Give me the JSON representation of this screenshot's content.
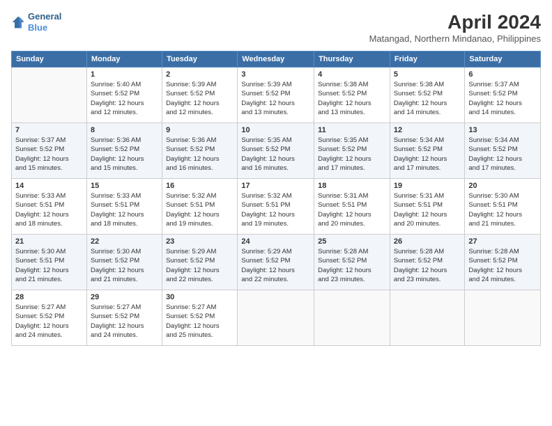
{
  "header": {
    "logo": {
      "general": "General",
      "blue": "Blue"
    },
    "title": "April 2024",
    "location": "Matangad, Northern Mindanao, Philippines"
  },
  "columns": [
    "Sunday",
    "Monday",
    "Tuesday",
    "Wednesday",
    "Thursday",
    "Friday",
    "Saturday"
  ],
  "weeks": [
    [
      {
        "day": "",
        "sunrise": "",
        "sunset": "",
        "daylight": ""
      },
      {
        "day": "1",
        "sunrise": "Sunrise: 5:40 AM",
        "sunset": "Sunset: 5:52 PM",
        "daylight": "Daylight: 12 hours and 12 minutes."
      },
      {
        "day": "2",
        "sunrise": "Sunrise: 5:39 AM",
        "sunset": "Sunset: 5:52 PM",
        "daylight": "Daylight: 12 hours and 12 minutes."
      },
      {
        "day": "3",
        "sunrise": "Sunrise: 5:39 AM",
        "sunset": "Sunset: 5:52 PM",
        "daylight": "Daylight: 12 hours and 13 minutes."
      },
      {
        "day": "4",
        "sunrise": "Sunrise: 5:38 AM",
        "sunset": "Sunset: 5:52 PM",
        "daylight": "Daylight: 12 hours and 13 minutes."
      },
      {
        "day": "5",
        "sunrise": "Sunrise: 5:38 AM",
        "sunset": "Sunset: 5:52 PM",
        "daylight": "Daylight: 12 hours and 14 minutes."
      },
      {
        "day": "6",
        "sunrise": "Sunrise: 5:37 AM",
        "sunset": "Sunset: 5:52 PM",
        "daylight": "Daylight: 12 hours and 14 minutes."
      }
    ],
    [
      {
        "day": "7",
        "sunrise": "Sunrise: 5:37 AM",
        "sunset": "Sunset: 5:52 PM",
        "daylight": "Daylight: 12 hours and 15 minutes."
      },
      {
        "day": "8",
        "sunrise": "Sunrise: 5:36 AM",
        "sunset": "Sunset: 5:52 PM",
        "daylight": "Daylight: 12 hours and 15 minutes."
      },
      {
        "day": "9",
        "sunrise": "Sunrise: 5:36 AM",
        "sunset": "Sunset: 5:52 PM",
        "daylight": "Daylight: 12 hours and 16 minutes."
      },
      {
        "day": "10",
        "sunrise": "Sunrise: 5:35 AM",
        "sunset": "Sunset: 5:52 PM",
        "daylight": "Daylight: 12 hours and 16 minutes."
      },
      {
        "day": "11",
        "sunrise": "Sunrise: 5:35 AM",
        "sunset": "Sunset: 5:52 PM",
        "daylight": "Daylight: 12 hours and 17 minutes."
      },
      {
        "day": "12",
        "sunrise": "Sunrise: 5:34 AM",
        "sunset": "Sunset: 5:52 PM",
        "daylight": "Daylight: 12 hours and 17 minutes."
      },
      {
        "day": "13",
        "sunrise": "Sunrise: 5:34 AM",
        "sunset": "Sunset: 5:52 PM",
        "daylight": "Daylight: 12 hours and 17 minutes."
      }
    ],
    [
      {
        "day": "14",
        "sunrise": "Sunrise: 5:33 AM",
        "sunset": "Sunset: 5:51 PM",
        "daylight": "Daylight: 12 hours and 18 minutes."
      },
      {
        "day": "15",
        "sunrise": "Sunrise: 5:33 AM",
        "sunset": "Sunset: 5:51 PM",
        "daylight": "Daylight: 12 hours and 18 minutes."
      },
      {
        "day": "16",
        "sunrise": "Sunrise: 5:32 AM",
        "sunset": "Sunset: 5:51 PM",
        "daylight": "Daylight: 12 hours and 19 minutes."
      },
      {
        "day": "17",
        "sunrise": "Sunrise: 5:32 AM",
        "sunset": "Sunset: 5:51 PM",
        "daylight": "Daylight: 12 hours and 19 minutes."
      },
      {
        "day": "18",
        "sunrise": "Sunrise: 5:31 AM",
        "sunset": "Sunset: 5:51 PM",
        "daylight": "Daylight: 12 hours and 20 minutes."
      },
      {
        "day": "19",
        "sunrise": "Sunrise: 5:31 AM",
        "sunset": "Sunset: 5:51 PM",
        "daylight": "Daylight: 12 hours and 20 minutes."
      },
      {
        "day": "20",
        "sunrise": "Sunrise: 5:30 AM",
        "sunset": "Sunset: 5:51 PM",
        "daylight": "Daylight: 12 hours and 21 minutes."
      }
    ],
    [
      {
        "day": "21",
        "sunrise": "Sunrise: 5:30 AM",
        "sunset": "Sunset: 5:51 PM",
        "daylight": "Daylight: 12 hours and 21 minutes."
      },
      {
        "day": "22",
        "sunrise": "Sunrise: 5:30 AM",
        "sunset": "Sunset: 5:52 PM",
        "daylight": "Daylight: 12 hours and 21 minutes."
      },
      {
        "day": "23",
        "sunrise": "Sunrise: 5:29 AM",
        "sunset": "Sunset: 5:52 PM",
        "daylight": "Daylight: 12 hours and 22 minutes."
      },
      {
        "day": "24",
        "sunrise": "Sunrise: 5:29 AM",
        "sunset": "Sunset: 5:52 PM",
        "daylight": "Daylight: 12 hours and 22 minutes."
      },
      {
        "day": "25",
        "sunrise": "Sunrise: 5:28 AM",
        "sunset": "Sunset: 5:52 PM",
        "daylight": "Daylight: 12 hours and 23 minutes."
      },
      {
        "day": "26",
        "sunrise": "Sunrise: 5:28 AM",
        "sunset": "Sunset: 5:52 PM",
        "daylight": "Daylight: 12 hours and 23 minutes."
      },
      {
        "day": "27",
        "sunrise": "Sunrise: 5:28 AM",
        "sunset": "Sunset: 5:52 PM",
        "daylight": "Daylight: 12 hours and 24 minutes."
      }
    ],
    [
      {
        "day": "28",
        "sunrise": "Sunrise: 5:27 AM",
        "sunset": "Sunset: 5:52 PM",
        "daylight": "Daylight: 12 hours and 24 minutes."
      },
      {
        "day": "29",
        "sunrise": "Sunrise: 5:27 AM",
        "sunset": "Sunset: 5:52 PM",
        "daylight": "Daylight: 12 hours and 24 minutes."
      },
      {
        "day": "30",
        "sunrise": "Sunrise: 5:27 AM",
        "sunset": "Sunset: 5:52 PM",
        "daylight": "Daylight: 12 hours and 25 minutes."
      },
      {
        "day": "",
        "sunrise": "",
        "sunset": "",
        "daylight": ""
      },
      {
        "day": "",
        "sunrise": "",
        "sunset": "",
        "daylight": ""
      },
      {
        "day": "",
        "sunrise": "",
        "sunset": "",
        "daylight": ""
      },
      {
        "day": "",
        "sunrise": "",
        "sunset": "",
        "daylight": ""
      }
    ]
  ]
}
